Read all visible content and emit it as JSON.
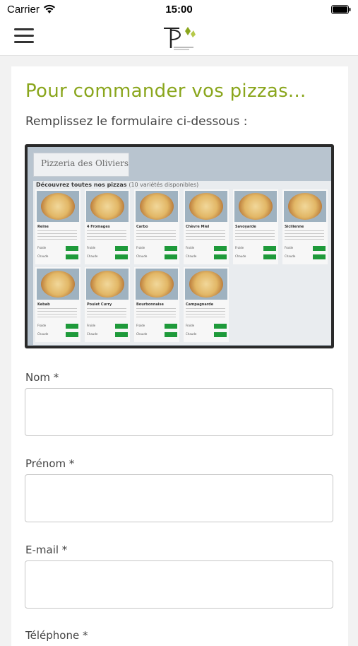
{
  "status_bar": {
    "carrier": "Carrier",
    "time": "15:00"
  },
  "header": {
    "menu_icon": "hamburger-menu-icon",
    "logo_icon": "pizzeria-logo"
  },
  "main": {
    "title": "Pour commander vos pizzas...",
    "subtitle": "Remplissez le formulaire ci-dessous :"
  },
  "menu_image": {
    "header_title": "Pizzeria des Oliviers",
    "heading": "Découvrez toutes nos pizzas",
    "heading_count": "(10 variétés disponibles)",
    "price_labels": [
      "Froide",
      "Chaude"
    ],
    "pizzas": [
      "Reine",
      "4 Fromages",
      "Carbo",
      "Chèvre Miel",
      "Savoyarde",
      "Sicilienne",
      "Kebab",
      "Poulet Curry",
      "Bourbonnaise",
      "Campagnarde"
    ]
  },
  "form": {
    "fields": [
      {
        "label": "Nom *",
        "value": ""
      },
      {
        "label": "Prénom *",
        "value": ""
      },
      {
        "label": "E-mail *",
        "value": ""
      },
      {
        "label": "Téléphone *",
        "value": ""
      }
    ]
  },
  "colors": {
    "accent": "#8aa61d",
    "price_tag": "#1e9a3a"
  }
}
